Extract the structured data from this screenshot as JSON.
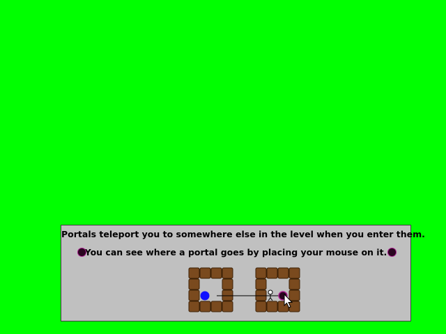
{
  "game": {
    "background_color": "#00ff00"
  },
  "tutorial": {
    "line1": "Portals teleport you to somewhere else in the level when you enter them.",
    "line2": "You can see where a portal goes by placing your mouse on it.",
    "panel_color": "#c0c0c0"
  },
  "demo": {
    "tile": "brick-block",
    "tile_color": "#7a4a1e",
    "portal_entry_color": "#1010ff",
    "portal_exit_color": "#2a0520",
    "portal_ring_color": "#a8208e",
    "link_line": "portal-destination-line",
    "icons": [
      "player-icon",
      "mouse-cursor-icon",
      "portal-icon"
    ]
  }
}
